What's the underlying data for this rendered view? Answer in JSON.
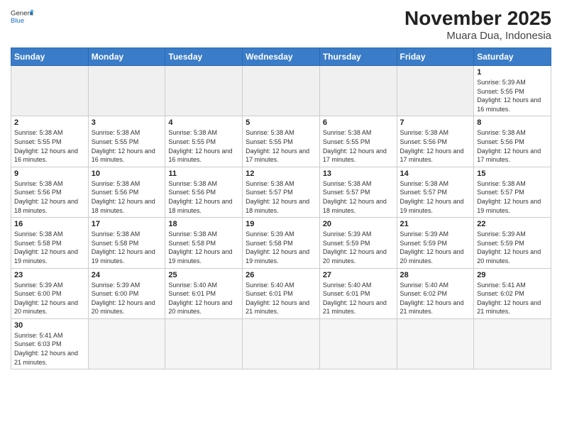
{
  "header": {
    "logo_general": "General",
    "logo_blue": "Blue",
    "title": "November 2025",
    "subtitle": "Muara Dua, Indonesia"
  },
  "days_of_week": [
    "Sunday",
    "Monday",
    "Tuesday",
    "Wednesday",
    "Thursday",
    "Friday",
    "Saturday"
  ],
  "weeks": [
    [
      {
        "day": "",
        "empty": true
      },
      {
        "day": "",
        "empty": true
      },
      {
        "day": "",
        "empty": true
      },
      {
        "day": "",
        "empty": true
      },
      {
        "day": "",
        "empty": true
      },
      {
        "day": "",
        "empty": true
      },
      {
        "day": "1",
        "sunrise": "5:39 AM",
        "sunset": "5:55 PM",
        "daylight": "12 hours and 16 minutes."
      }
    ],
    [
      {
        "day": "2",
        "sunrise": "5:38 AM",
        "sunset": "5:55 PM",
        "daylight": "12 hours and 16 minutes."
      },
      {
        "day": "3",
        "sunrise": "5:38 AM",
        "sunset": "5:55 PM",
        "daylight": "12 hours and 16 minutes."
      },
      {
        "day": "4",
        "sunrise": "5:38 AM",
        "sunset": "5:55 PM",
        "daylight": "12 hours and 16 minutes."
      },
      {
        "day": "5",
        "sunrise": "5:38 AM",
        "sunset": "5:55 PM",
        "daylight": "12 hours and 17 minutes."
      },
      {
        "day": "6",
        "sunrise": "5:38 AM",
        "sunset": "5:55 PM",
        "daylight": "12 hours and 17 minutes."
      },
      {
        "day": "7",
        "sunrise": "5:38 AM",
        "sunset": "5:56 PM",
        "daylight": "12 hours and 17 minutes."
      },
      {
        "day": "8",
        "sunrise": "5:38 AM",
        "sunset": "5:56 PM",
        "daylight": "12 hours and 17 minutes."
      }
    ],
    [
      {
        "day": "9",
        "sunrise": "5:38 AM",
        "sunset": "5:56 PM",
        "daylight": "12 hours and 18 minutes."
      },
      {
        "day": "10",
        "sunrise": "5:38 AM",
        "sunset": "5:56 PM",
        "daylight": "12 hours and 18 minutes."
      },
      {
        "day": "11",
        "sunrise": "5:38 AM",
        "sunset": "5:56 PM",
        "daylight": "12 hours and 18 minutes."
      },
      {
        "day": "12",
        "sunrise": "5:38 AM",
        "sunset": "5:57 PM",
        "daylight": "12 hours and 18 minutes."
      },
      {
        "day": "13",
        "sunrise": "5:38 AM",
        "sunset": "5:57 PM",
        "daylight": "12 hours and 18 minutes."
      },
      {
        "day": "14",
        "sunrise": "5:38 AM",
        "sunset": "5:57 PM",
        "daylight": "12 hours and 19 minutes."
      },
      {
        "day": "15",
        "sunrise": "5:38 AM",
        "sunset": "5:57 PM",
        "daylight": "12 hours and 19 minutes."
      }
    ],
    [
      {
        "day": "16",
        "sunrise": "5:38 AM",
        "sunset": "5:58 PM",
        "daylight": "12 hours and 19 minutes."
      },
      {
        "day": "17",
        "sunrise": "5:38 AM",
        "sunset": "5:58 PM",
        "daylight": "12 hours and 19 minutes."
      },
      {
        "day": "18",
        "sunrise": "5:38 AM",
        "sunset": "5:58 PM",
        "daylight": "12 hours and 19 minutes."
      },
      {
        "day": "19",
        "sunrise": "5:39 AM",
        "sunset": "5:58 PM",
        "daylight": "12 hours and 19 minutes."
      },
      {
        "day": "20",
        "sunrise": "5:39 AM",
        "sunset": "5:59 PM",
        "daylight": "12 hours and 20 minutes."
      },
      {
        "day": "21",
        "sunrise": "5:39 AM",
        "sunset": "5:59 PM",
        "daylight": "12 hours and 20 minutes."
      },
      {
        "day": "22",
        "sunrise": "5:39 AM",
        "sunset": "5:59 PM",
        "daylight": "12 hours and 20 minutes."
      }
    ],
    [
      {
        "day": "23",
        "sunrise": "5:39 AM",
        "sunset": "6:00 PM",
        "daylight": "12 hours and 20 minutes."
      },
      {
        "day": "24",
        "sunrise": "5:39 AM",
        "sunset": "6:00 PM",
        "daylight": "12 hours and 20 minutes."
      },
      {
        "day": "25",
        "sunrise": "5:40 AM",
        "sunset": "6:01 PM",
        "daylight": "12 hours and 20 minutes."
      },
      {
        "day": "26",
        "sunrise": "5:40 AM",
        "sunset": "6:01 PM",
        "daylight": "12 hours and 21 minutes."
      },
      {
        "day": "27",
        "sunrise": "5:40 AM",
        "sunset": "6:01 PM",
        "daylight": "12 hours and 21 minutes."
      },
      {
        "day": "28",
        "sunrise": "5:40 AM",
        "sunset": "6:02 PM",
        "daylight": "12 hours and 21 minutes."
      },
      {
        "day": "29",
        "sunrise": "5:41 AM",
        "sunset": "6:02 PM",
        "daylight": "12 hours and 21 minutes."
      }
    ],
    [
      {
        "day": "30",
        "sunrise": "5:41 AM",
        "sunset": "6:03 PM",
        "daylight": "12 hours and 21 minutes."
      },
      {
        "day": "",
        "empty": true
      },
      {
        "day": "",
        "empty": true
      },
      {
        "day": "",
        "empty": true
      },
      {
        "day": "",
        "empty": true
      },
      {
        "day": "",
        "empty": true
      },
      {
        "day": "",
        "empty": true
      }
    ]
  ],
  "labels": {
    "sunrise": "Sunrise:",
    "sunset": "Sunset:",
    "daylight": "Daylight:"
  }
}
